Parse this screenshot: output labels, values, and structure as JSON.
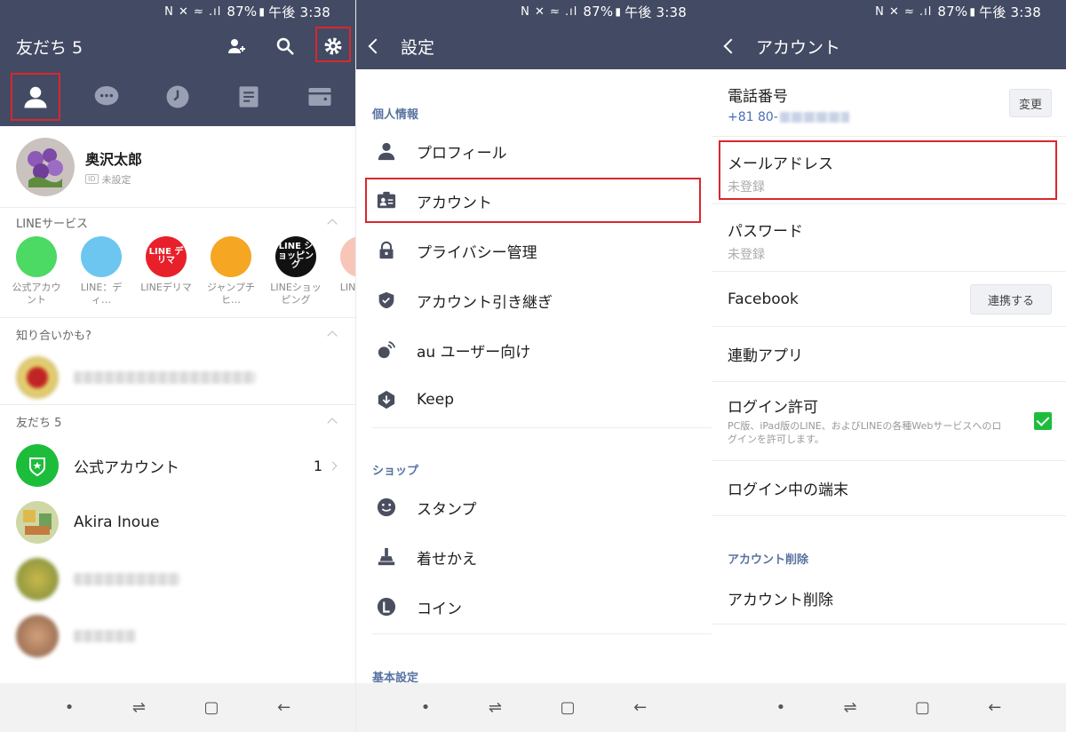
{
  "status": {
    "battery": "87%",
    "time": "午後 3:38"
  },
  "friends_screen": {
    "title": "友だち 5",
    "profile": {
      "name": "奥沢太郎",
      "id_status": "未設定"
    },
    "services_header": "LINEサービス",
    "services": [
      {
        "label": "公式アカウント",
        "icon_text": "",
        "color": "#4cd964"
      },
      {
        "label": "LINE：ディ…",
        "icon_text": "",
        "color": "#6cc6f0"
      },
      {
        "label": "LINEデリマ",
        "icon_text": "LINE デリマ",
        "color": "#e8202a"
      },
      {
        "label": "ジャンプチヒ…",
        "icon_text": "",
        "color": "#f5a623"
      },
      {
        "label": "LINEショッピング",
        "icon_text": "LINE ショッピング",
        "color": "#111111"
      },
      {
        "label": "LINEバ…",
        "icon_text": "",
        "color": "#f7c6b8"
      }
    ],
    "suggest_header": "知り合いかも?",
    "friends_header": "友だち 5",
    "friends": [
      {
        "name": "公式アカウント",
        "count": "1"
      },
      {
        "name": "Akira Inoue"
      }
    ]
  },
  "settings_screen": {
    "title": "設定",
    "group1": "個人情報",
    "items1": [
      "プロフィール",
      "アカウント",
      "プライバシー管理",
      "アカウント引き継ぎ",
      "au ユーザー向け",
      "Keep"
    ],
    "group2": "ショップ",
    "items2": [
      "スタンプ",
      "着せかえ",
      "コイン"
    ],
    "group3": "基本設定"
  },
  "account_screen": {
    "title": "アカウント",
    "phone_label": "電話番号",
    "phone_value": "+81 80-",
    "change_button": "変更",
    "email_label": "メールアドレス",
    "email_value": "未登録",
    "password_label": "パスワード",
    "password_value": "未登録",
    "facebook_label": "Facebook",
    "facebook_button": "連携する",
    "linked_apps": "連動アプリ",
    "login_permit": "ログイン許可",
    "login_permit_desc": "PC版、iPad版のLINE、およびLINEの各種Webサービスへのログインを許可します。",
    "login_devices": "ログイン中の端末",
    "delete_header": "アカウント削除",
    "delete_item": "アカウント削除"
  }
}
